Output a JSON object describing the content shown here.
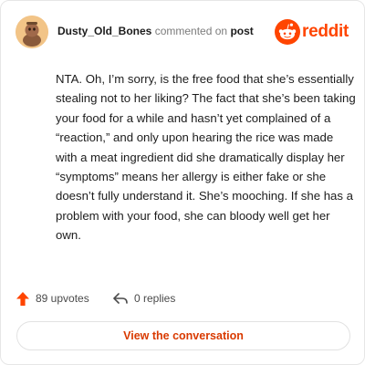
{
  "header": {
    "username": "Dusty_Old_Bones",
    "action_text": "commented on",
    "post_link": "post",
    "logo_text": "reddit"
  },
  "comment": {
    "text": "NTA. Oh, I’m sorry, is the free food that she’s essentially stealing not to her liking? The fact that she’s been taking your food for a while and hasn’t yet complained of a “reaction,” and only upon hearing the rice was made with a meat ingredient did she dramatically display her “symptoms” means her allergy is either fake or she doesn’t fully understand it. She’s mooching. If she has a problem with your food, she can bloody well get her own."
  },
  "actions": {
    "upvotes_label": "89 upvotes",
    "replies_label": "0 replies"
  },
  "footer": {
    "view_button_label": "View the conversation"
  },
  "colors": {
    "brand": "#ff4500",
    "button_text": "#d93a00"
  },
  "icons": {
    "avatar": "user-avatar",
    "logo": "reddit-snoo-icon",
    "upvote": "upvote-arrow-icon",
    "reply": "reply-arrow-icon"
  }
}
